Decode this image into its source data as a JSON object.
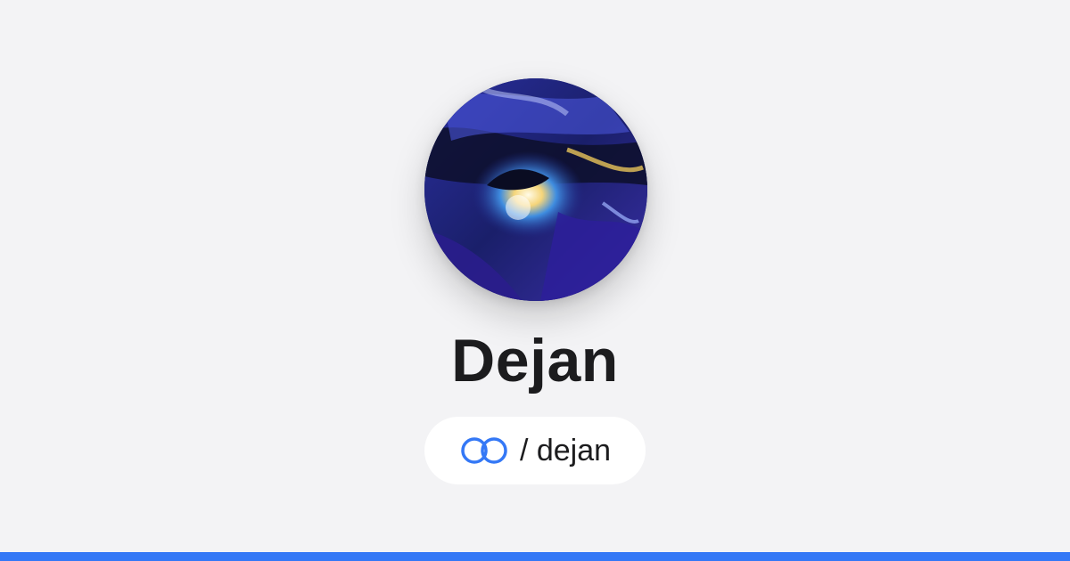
{
  "profile": {
    "display_name": "Dejan",
    "handle": "/ dejan"
  },
  "icons": {
    "avatar": "abstract-painting-avatar",
    "brand": "interlocked-rings-logo-icon"
  },
  "colors": {
    "page_background": "#f3f3f5",
    "accent": "#3478f6",
    "name_text": "#1c1c1e",
    "pill_background": "#ffffff"
  }
}
